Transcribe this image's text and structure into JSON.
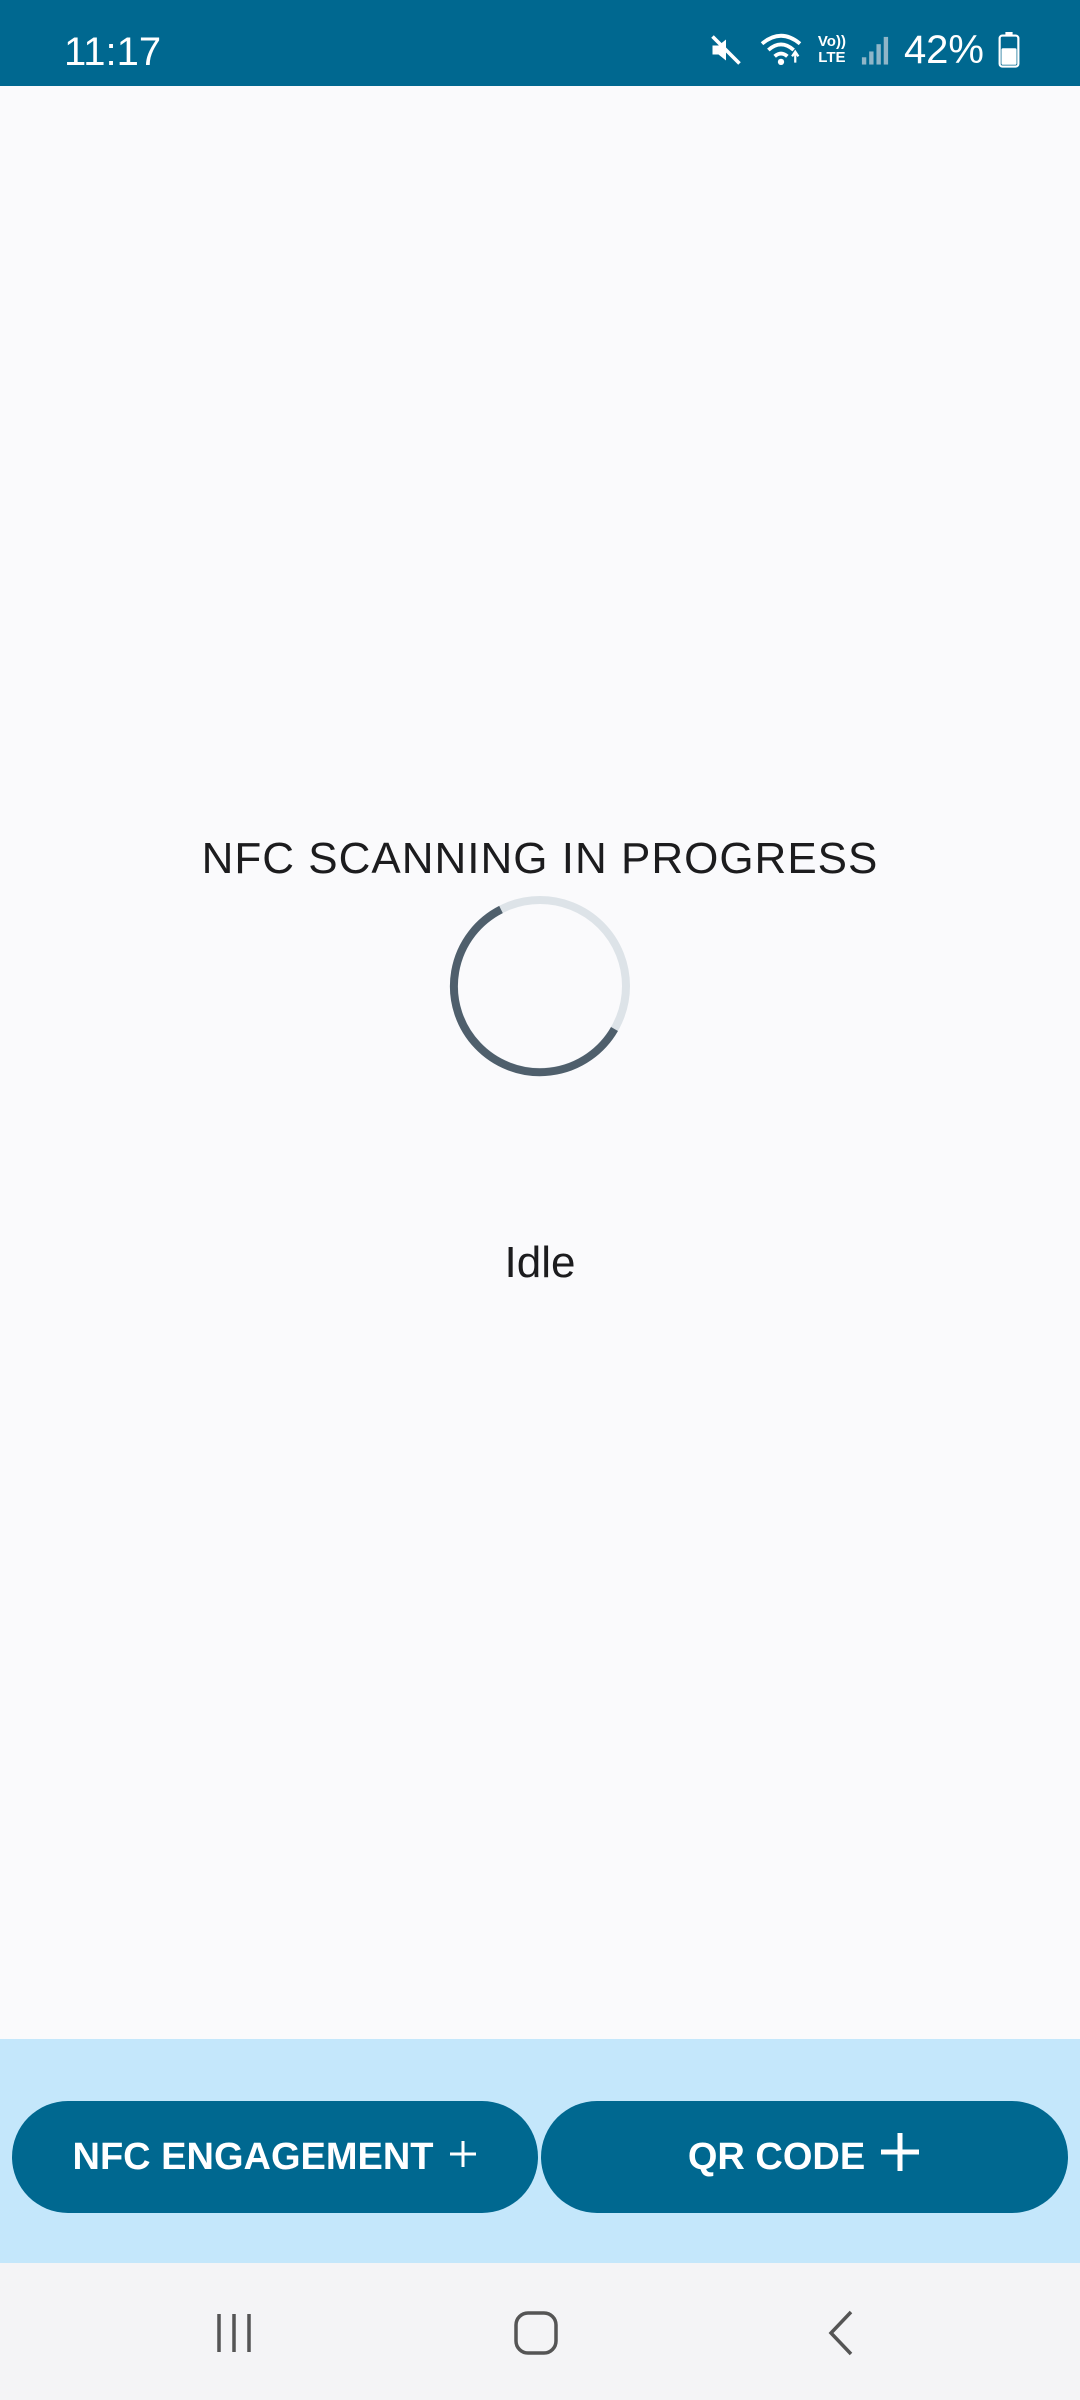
{
  "status_bar": {
    "time": "11:17",
    "battery_percent": "42%",
    "network_label": "Vo)) LTE",
    "icons": [
      "mute-icon",
      "wifi-icon",
      "volte-icon",
      "signal-icon",
      "battery-icon"
    ]
  },
  "main": {
    "title": "NFC SCANNING IN PROGRESS",
    "status": "Idle"
  },
  "actions": {
    "nfc_label": "NFC ENGAGEMENT",
    "qr_label": "QR CODE"
  },
  "navigation": {
    "icons": [
      "recents-icon",
      "home-icon",
      "back-icon"
    ]
  },
  "colors": {
    "primary": "#006890",
    "panel": "#c4e7fb",
    "background": "#fafafc",
    "spinner": "#4f5f6c",
    "spinner_track": "#dde3e8"
  }
}
